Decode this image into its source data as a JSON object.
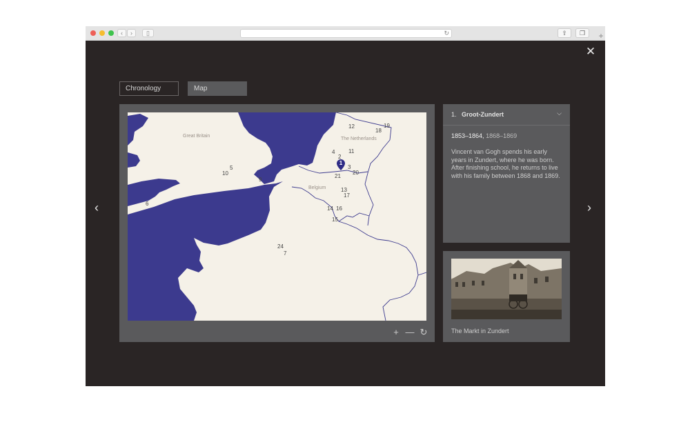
{
  "window": {
    "colors": {
      "red": "#ee5f57",
      "yellow": "#f5bd2f",
      "green": "#3fc34d"
    },
    "nav_back_icon": "chevron-left-icon",
    "nav_forward_icon": "chevron-right-icon",
    "reload_icon": "reload-icon",
    "share_icon": "share-icon",
    "tabs_icon": "tabs-icon"
  },
  "viewer": {
    "background": "#2a2525",
    "close_icon": "close-icon",
    "tabs": [
      {
        "label": "Chronology",
        "active": false
      },
      {
        "label": "Map",
        "active": true
      }
    ],
    "prev_icon": "chevron-left-icon",
    "next_icon": "chevron-right-icon"
  },
  "map": {
    "sea_color": "#3c3a8e",
    "land_color": "#f5f1e8",
    "labels": {
      "great_britain": "Great Britain",
      "netherlands": "The Netherlands",
      "belgium": "Belgium"
    },
    "numbers": {
      "n12": "12",
      "n18": "18",
      "n19": "19",
      "n4": "4",
      "n11": "11",
      "n2": "2",
      "n3": "3",
      "n20": "20",
      "n21": "21",
      "n5": "5",
      "n10": "10",
      "n9": "9",
      "n13": "13",
      "n17": "17",
      "n6": "6",
      "n14": "14",
      "n16": "16",
      "n15": "15",
      "n24": "24",
      "n7": "7"
    },
    "marker_label": "1",
    "controls": {
      "zoom_in": "+",
      "zoom_out": "—",
      "reset_icon": "reset-icon"
    }
  },
  "detail": {
    "number": "1.",
    "title": "Groot-Zundert",
    "dates_primary": "1853–1864,",
    "dates_secondary": "1868–1869",
    "description": "Vincent van Gogh spends his early years in Zundert, where he was born. After finishing school, he returns to live with his family between 1868 and 1869.",
    "expand_icon": "chevron-down-icon"
  },
  "photo": {
    "caption": "The Markt in Zundert"
  }
}
